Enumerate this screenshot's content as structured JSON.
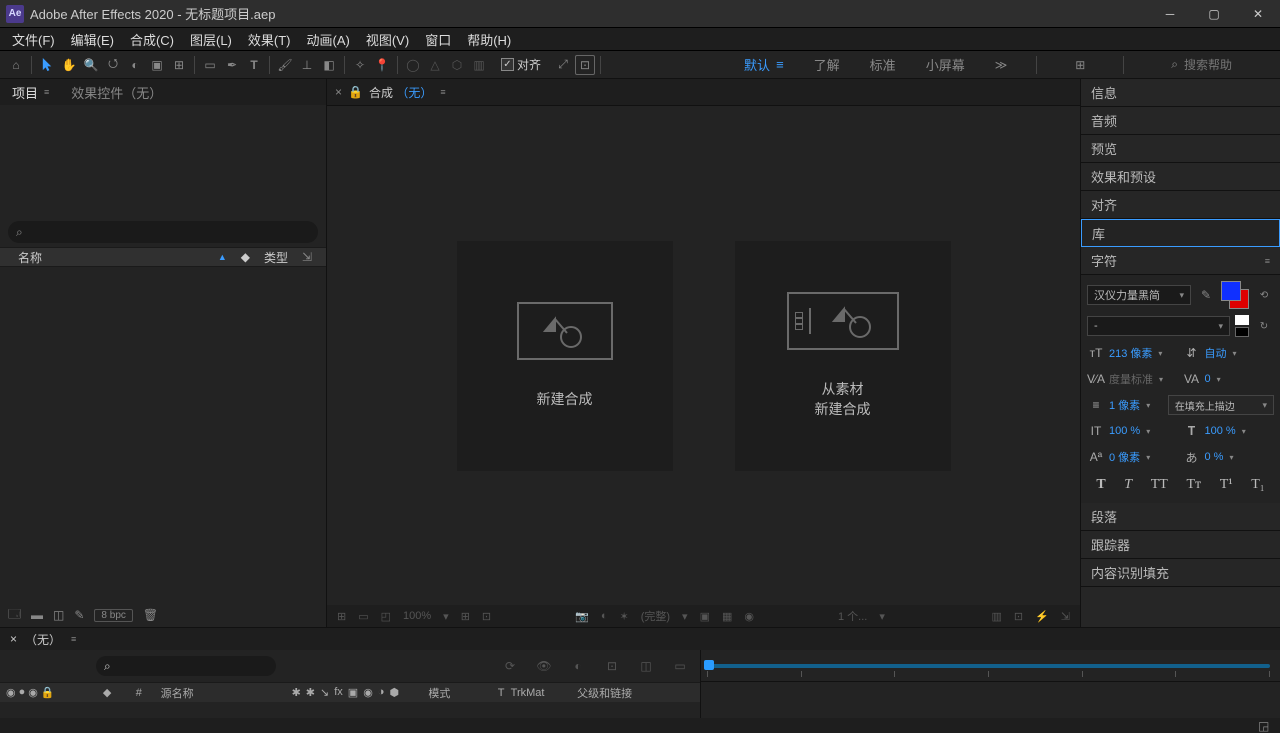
{
  "titlebar": {
    "app": "Adobe After Effects 2020",
    "project": "无标题项目.aep"
  },
  "menu": [
    "文件(F)",
    "编辑(E)",
    "合成(C)",
    "图层(L)",
    "效果(T)",
    "动画(A)",
    "视图(V)",
    "窗口",
    "帮助(H)"
  ],
  "toolbar": {
    "align_label": "对齐"
  },
  "workspace": {
    "tabs": [
      "默认",
      "了解",
      "标准",
      "小屏幕"
    ],
    "search_ph": "搜索帮助"
  },
  "project": {
    "tab_project": "项目",
    "tab_effects": "效果控件（无）",
    "col_name": "名称",
    "col_type": "类型",
    "bpc": "8 bpc"
  },
  "composition": {
    "tab_label": "合成",
    "none": "（无）",
    "new_comp": "新建合成",
    "from_footage": "从素材\n新建合成",
    "zoom": "100%",
    "full": "(完整)",
    "view1": "1 个..."
  },
  "sidepanels": [
    "信息",
    "音频",
    "预览",
    "效果和预设",
    "对齐",
    "库",
    "字符",
    "段落",
    "跟踪器",
    "内容识别填充"
  ],
  "character": {
    "font": "汉仪力量黑简",
    "style": "-",
    "size": "213 像素",
    "leading": "自动",
    "kerning": "度量标准",
    "tracking": "0",
    "stroke_w": "1 像素",
    "stroke_pos": "在填充上描边",
    "vscale": "100 %",
    "hscale": "100 %",
    "baseline": "0 像素",
    "tsume": "0 %"
  },
  "timeline": {
    "tab_none": "（无）",
    "col_source": "源名称",
    "col_mode": "模式",
    "col_trk_t": "T",
    "col_trk": "TrkMat",
    "col_parent": "父级和链接",
    "col_hash": "#"
  }
}
